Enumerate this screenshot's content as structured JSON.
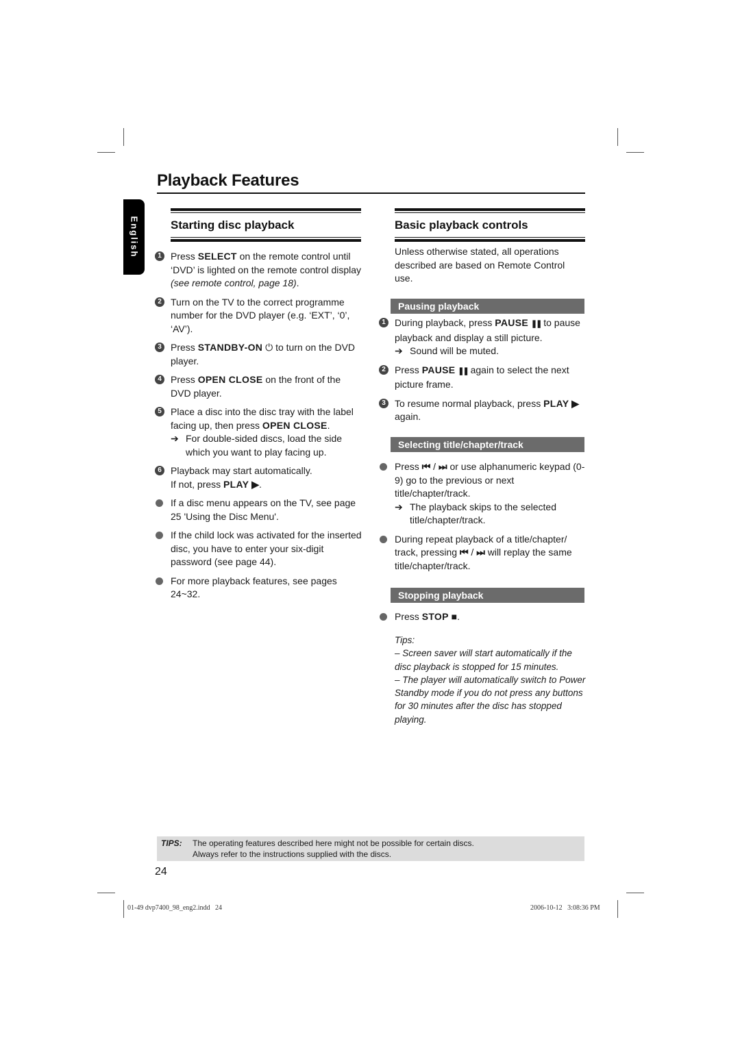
{
  "page": {
    "title": "Playback Features",
    "language_tab": "English",
    "page_number": "24"
  },
  "left_section": {
    "heading": "Starting disc playback",
    "steps": [
      {
        "marker": "1",
        "parts": [
          "Press ",
          "SELECT",
          " on the remote control until ‘DVD’ is lighted on the remote control display ",
          "(see remote control, page 18)",
          "."
        ]
      },
      {
        "marker": "2",
        "text": "Turn on the TV to the correct programme number for the DVD player (e.g. ‘EXT’, ‘0’, ‘AV’)."
      },
      {
        "marker": "3",
        "pre": "Press ",
        "bold": "STANDBY-ON",
        "icon": "power-icon",
        "post": " to turn on the DVD player."
      },
      {
        "marker": "4",
        "pre": "Press ",
        "bold": "OPEN CLOSE",
        "post": " on the front of the DVD player."
      },
      {
        "marker": "5",
        "pre": "Place a disc into the disc tray with the label facing up, then press ",
        "bold": "OPEN CLOSE",
        "post": ".",
        "result": "For double-sided discs, load the side which you want to play facing up."
      },
      {
        "marker": "6",
        "line1": "Playback may start automatically.",
        "pre": "If not, press ",
        "bold": "PLAY",
        "icon": "play-icon",
        "post": "."
      }
    ],
    "bullets": [
      "If a disc menu appears on the TV, see page 25 'Using the Disc Menu'.",
      "If the child lock was activated for the inserted disc, you have to enter your six-digit password (see page 44).",
      "For more playback features, see pages 24~32."
    ]
  },
  "right_section": {
    "heading": "Basic playback controls",
    "intro": "Unless otherwise stated, all operations described are based on Remote Control use.",
    "pausing": {
      "heading": "Pausing playback",
      "steps": [
        {
          "marker": "1",
          "pre": "During playback, press ",
          "bold": "PAUSE",
          "icon": "pause-icon",
          "post": " to pause playback and display a still picture.",
          "result": "Sound will be muted."
        },
        {
          "marker": "2",
          "pre": "Press ",
          "bold": "PAUSE",
          "icon": "pause-icon",
          "post": " again to select the next picture frame."
        },
        {
          "marker": "3",
          "pre": "To resume normal playback, press ",
          "bold": "PLAY",
          "icon": "play-icon",
          "post": " again."
        }
      ]
    },
    "selecting": {
      "heading": "Selecting title/chapter/track",
      "bullets": [
        {
          "pre": "Press ",
          "icons": [
            "previous-icon",
            "next-icon"
          ],
          "post": " or use alphanumeric keypad (0-9) go to the previous or next title/chapter/track.",
          "result": "The playback skips to the selected title/chapter/track."
        },
        {
          "pre": "During repeat playback of a title/chapter/ track, pressing ",
          "icons": [
            "previous-icon",
            "next-icon"
          ],
          "post": " will replay the same title/chapter/track."
        }
      ]
    },
    "stopping": {
      "heading": "Stopping playback",
      "bullet": {
        "pre": "Press ",
        "bold": "STOP",
        "icon": "stop-icon",
        "post": "."
      },
      "tips_label": "Tips:",
      "tips": [
        "– Screen saver will start automatically if the disc playback is stopped for 15 minutes.",
        "– The player will automatically switch to Power Standby mode if you do not press any buttons for 30 minutes after the disc has stopped playing."
      ]
    }
  },
  "footer": {
    "tips_label": "TIPS:",
    "tips_line1": "The operating features described here might not be possible for certain discs.",
    "tips_line2": "Always refer to the instructions supplied with the discs.",
    "slug_left": "01-49 dvp7400_98_eng2.indd   24",
    "slug_right": "2006-10-12   3:08:36 PM"
  },
  "glyphs": {
    "arrow": "➔",
    "power": "⏻",
    "play": "▶",
    "pause": "❚❚",
    "stop": "■",
    "previous": "⏮",
    "next": "⏭",
    "slash": " / "
  }
}
